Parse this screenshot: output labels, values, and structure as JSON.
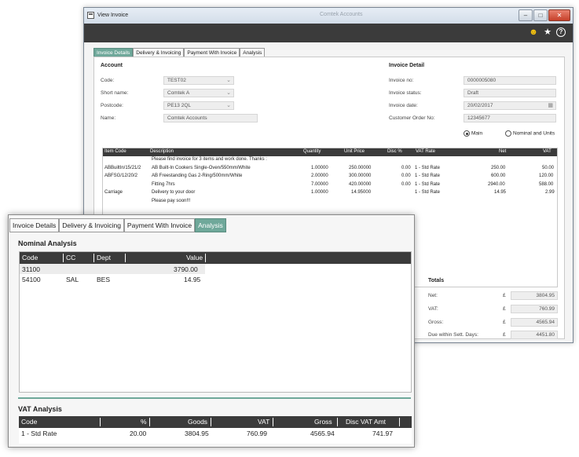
{
  "back": {
    "title": "View Invoice",
    "ghost_title": "Comtek Accounts",
    "tabs": [
      "Invoice Details",
      "Delivery & Invoicing",
      "Payment With Invoice",
      "Analysis"
    ],
    "account_heading": "Account",
    "invoice_heading": "Invoice Detail",
    "fields": {
      "code_label": "Code:",
      "code_value": "TEST02",
      "short_label": "Short name:",
      "short_value": "Comtek A",
      "post_label": "Postcode:",
      "post_value": "PE13 2QL",
      "name_label": "Name:",
      "name_value": "Comtek Accounts",
      "invno_label": "Invoice no:",
      "invno_value": "0000005080",
      "status_label": "Invoice status:",
      "status_value": "Draft",
      "date_label": "Invoice date:",
      "date_value": "20/02/2017",
      "order_label": "Customer Order No:",
      "order_value": "12345677"
    },
    "radio_main": "Main",
    "radio_nominal": "Nominal and Units",
    "grid_headers": [
      "Item Code",
      "Description",
      "Quantity",
      "Unit Price",
      "Disc %",
      "VAT Rate",
      "Net",
      "VAT"
    ],
    "rows": [
      {
        "code": "",
        "desc": "Please find invoice for 3 items and work done.  Thanks :",
        "qty": "",
        "price": "",
        "disc": "",
        "vat_rate": "",
        "net": "",
        "vat": ""
      },
      {
        "code": "ABBuiltIn/15/21/2",
        "desc": "AB Built-In Cookers Single-Oven/550mm/White",
        "qty": "1.00000",
        "price": "250.00000",
        "disc": "0.00",
        "vat_rate": "1 - Std Rate",
        "net": "250.00",
        "vat": "50.00"
      },
      {
        "code": "ABFSG/12/20/2",
        "desc": "AB Freestanding Gas 2-Ring/500mm/White",
        "qty": "2.00000",
        "price": "300.00000",
        "disc": "0.00",
        "vat_rate": "1 - Std Rate",
        "net": "600.00",
        "vat": "120.00"
      },
      {
        "code": "",
        "desc": "Fitting 7hrs",
        "qty": "7.00000",
        "price": "420.00000",
        "disc": "0.00",
        "vat_rate": "1 - Std Rate",
        "net": "2940.00",
        "vat": "588.00"
      },
      {
        "code": "Carriage",
        "desc": "Delivery to your door",
        "qty": "1.00000",
        "price": "14.95000",
        "disc": "",
        "vat_rate": "1 - Std Rate",
        "net": "14.95",
        "vat": "2.99"
      },
      {
        "code": "",
        "desc": "Please pay soon!!!",
        "qty": "",
        "price": "",
        "disc": "",
        "vat_rate": "",
        "net": "",
        "vat": ""
      }
    ],
    "totals_heading": "Totals",
    "totals": [
      {
        "label": "Net:",
        "cur": "£",
        "value": "3804.95"
      },
      {
        "label": "VAT:",
        "cur": "£",
        "value": "760.99"
      },
      {
        "label": "Gross:",
        "cur": "£",
        "value": "4565.94"
      },
      {
        "label": "Due within Sett. Days:",
        "cur": "£",
        "value": "4451.80"
      }
    ]
  },
  "front": {
    "tabs": [
      "Invoice Details",
      "Delivery & Invoicing",
      "Payment With Invoice",
      "Analysis"
    ],
    "nominal_heading": "Nominal Analysis",
    "nominal_headers": [
      "Code",
      "CC",
      "Dept",
      "Value"
    ],
    "nominal_rows": [
      {
        "code": "31100",
        "cc": "",
        "dept": "",
        "value": "3790.00"
      },
      {
        "code": "54100",
        "cc": "SAL",
        "dept": "BES",
        "value": "14.95"
      }
    ],
    "vat_heading": "VAT Analysis",
    "vat_headers": [
      "Code",
      "%",
      "Goods",
      "VAT",
      "Gross",
      "Disc VAT Amt"
    ],
    "vat_rows": [
      {
        "code": "1 - Std Rate",
        "pct": "20.00",
        "goods": "3804.95",
        "vat": "760.99",
        "gross": "4565.94",
        "disc": "741.97"
      }
    ]
  },
  "colors": {
    "accent": "#6fa89a",
    "header_dark": "#3b3b3b",
    "smiley": "#f3c10f"
  },
  "icons": [
    "smiley-icon",
    "star-icon",
    "help-icon",
    "calendar-icon",
    "chevron-down-icon"
  ]
}
